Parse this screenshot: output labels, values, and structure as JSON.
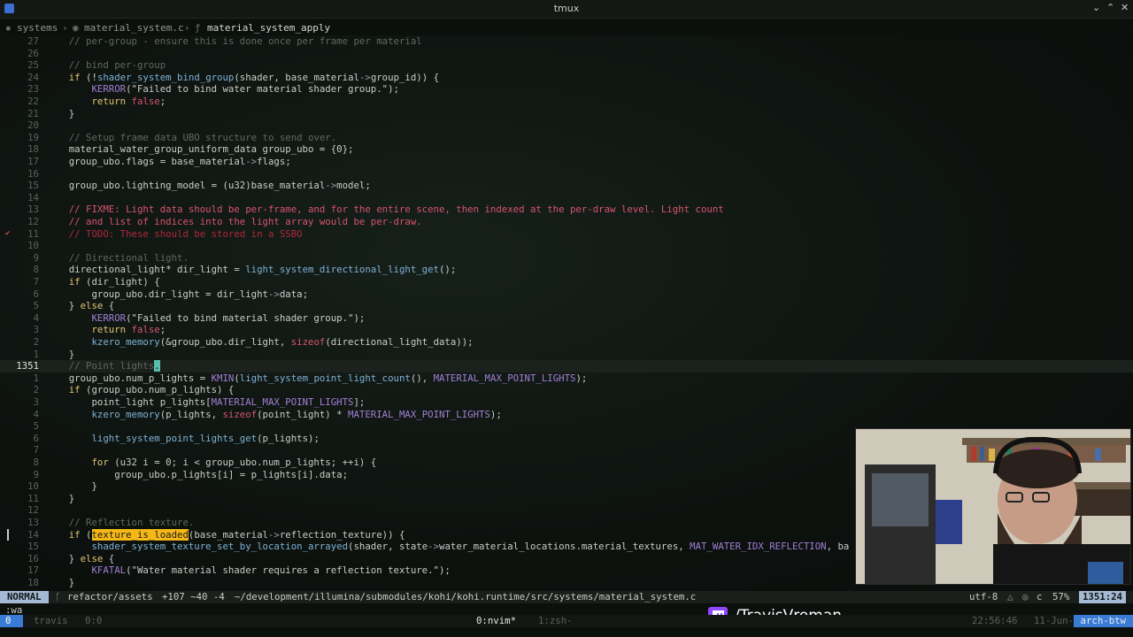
{
  "window": {
    "title": "tmux"
  },
  "window_controls": [
    "⌄",
    "⌃",
    "◇",
    "✕"
  ],
  "breadcrumb": {
    "folder": "systems",
    "file": "material_system.c",
    "function": "material_system_apply"
  },
  "lines": [
    {
      "ln": "27",
      "sign": "",
      "cursor": false,
      "html": "    <span class='cm'>// per-group - ensure this is done once per frame per material</span>"
    },
    {
      "ln": "26",
      "sign": "",
      "cursor": false,
      "html": ""
    },
    {
      "ln": "25",
      "sign": "",
      "cursor": false,
      "html": "    <span class='cm'>// bind per-group</span>"
    },
    {
      "ln": "24",
      "sign": "",
      "cursor": false,
      "html": "    <span class='kw'>if</span> (!<span class='fn'>shader_system_bind_group</span>(shader, base_material<span class='ptr'>-&gt;</span>group_id)) {"
    },
    {
      "ln": "23",
      "sign": "",
      "cursor": false,
      "html": "        <span class='mac'>KERROR</span>(\"Failed to bind water material shader group.\");"
    },
    {
      "ln": "22",
      "sign": "",
      "cursor": false,
      "html": "        <span class='kw'>return</span> <span class='fx'>false</span>;"
    },
    {
      "ln": "21",
      "sign": "",
      "cursor": false,
      "html": "    }"
    },
    {
      "ln": "20",
      "sign": "",
      "cursor": false,
      "html": ""
    },
    {
      "ln": "19",
      "sign": "",
      "cursor": false,
      "html": "    <span class='cm'>// Setup frame data UBO structure to send over.</span>"
    },
    {
      "ln": "18",
      "sign": "",
      "cursor": false,
      "html": "    material_water_group_uniform_data group_ubo = {0};"
    },
    {
      "ln": "17",
      "sign": "",
      "cursor": false,
      "html": "    group_ubo.flags = base_material<span class='ptr'>-&gt;</span>flags;"
    },
    {
      "ln": "16",
      "sign": "",
      "cursor": false,
      "html": ""
    },
    {
      "ln": "15",
      "sign": "",
      "cursor": false,
      "html": "    group_ubo.lighting_model = (u32)base_material<span class='ptr'>-&gt;</span>model;"
    },
    {
      "ln": "14",
      "sign": "",
      "cursor": false,
      "html": ""
    },
    {
      "ln": "13",
      "sign": "",
      "cursor": false,
      "html": "    <span class='fx'>// FIXME: Light data should be per-frame, and for the entire scene, then indexed at the per-draw level. Light count</span>"
    },
    {
      "ln": "12",
      "sign": "",
      "cursor": false,
      "html": "    <span class='fx'>// and list of indices into the light array would be per-draw.</span>"
    },
    {
      "ln": "11",
      "sign": "check",
      "cursor": false,
      "html": "    <span class='todo'>// TODO: These should be stored in a SSBO</span>"
    },
    {
      "ln": "10",
      "sign": "",
      "cursor": false,
      "html": ""
    },
    {
      "ln": "9",
      "sign": "",
      "cursor": false,
      "html": "    <span class='cm'>// Directional light.</span>"
    },
    {
      "ln": "8",
      "sign": "",
      "cursor": false,
      "html": "    directional_light* dir_light = <span class='fn'>light_system_directional_light_get</span>();"
    },
    {
      "ln": "7",
      "sign": "",
      "cursor": false,
      "html": "    <span class='kw'>if</span> (dir_light) {"
    },
    {
      "ln": "6",
      "sign": "",
      "cursor": false,
      "html": "        group_ubo.dir_light = dir_light<span class='ptr'>-&gt;</span>data;"
    },
    {
      "ln": "5",
      "sign": "",
      "cursor": false,
      "html": "    } <span class='kw'>else</span> {"
    },
    {
      "ln": "4",
      "sign": "",
      "cursor": false,
      "html": "        <span class='mac'>KERROR</span>(\"Failed to bind material shader group.\");"
    },
    {
      "ln": "3",
      "sign": "",
      "cursor": false,
      "html": "        <span class='kw'>return</span> <span class='fx'>false</span>;"
    },
    {
      "ln": "2",
      "sign": "",
      "cursor": false,
      "html": "        <span class='fn'>kzero_memory</span>(&amp;group_ubo.dir_light, <span class='fx'>sizeof</span>(directional_light_data));"
    },
    {
      "ln": "1",
      "sign": "",
      "cursor": false,
      "html": "    }"
    },
    {
      "ln": "1351",
      "sign": "",
      "cursor": true,
      "html": "    <span class='cm'>// Point lights</span><span class='cur'>.</span>"
    },
    {
      "ln": "1",
      "sign": "",
      "cursor": false,
      "html": "    group_ubo.num_p_lights = <span class='mac'>KMIN</span>(<span class='fn'>light_system_point_light_count</span>(), <span class='mac'>MATERIAL_MAX_POINT_LIGHTS</span>);"
    },
    {
      "ln": "2",
      "sign": "",
      "cursor": false,
      "html": "    <span class='kw'>if</span> (group_ubo.num_p_lights) {"
    },
    {
      "ln": "3",
      "sign": "",
      "cursor": false,
      "html": "        point_light p_lights[<span class='mac'>MATERIAL_MAX_POINT_LIGHTS</span>];"
    },
    {
      "ln": "4",
      "sign": "",
      "cursor": false,
      "html": "        <span class='fn'>kzero_memory</span>(p_lights, <span class='fx'>sizeof</span>(point_light) * <span class='mac'>MATERIAL_MAX_POINT_LIGHTS</span>);"
    },
    {
      "ln": "5",
      "sign": "",
      "cursor": false,
      "html": ""
    },
    {
      "ln": "6",
      "sign": "",
      "cursor": false,
      "html": "        <span class='fn'>light_system_point_lights_get</span>(p_lights);"
    },
    {
      "ln": "7",
      "sign": "",
      "cursor": false,
      "html": ""
    },
    {
      "ln": "8",
      "sign": "",
      "cursor": false,
      "html": "        <span class='kw'>for</span> (u32 i = 0; i &lt; group_ubo.num_p_lights; ++i) {"
    },
    {
      "ln": "9",
      "sign": "",
      "cursor": false,
      "html": "            group_ubo.p_lights[i] = p_lights[i].data;"
    },
    {
      "ln": "10",
      "sign": "",
      "cursor": false,
      "html": "        }"
    },
    {
      "ln": "11",
      "sign": "",
      "cursor": false,
      "html": "    }"
    },
    {
      "ln": "12",
      "sign": "",
      "cursor": false,
      "html": ""
    },
    {
      "ln": "13",
      "sign": "",
      "cursor": false,
      "html": "    <span class='cm'>// Reflection texture.</span>"
    },
    {
      "ln": "14",
      "sign": "bar",
      "cursor": false,
      "html": "    <span class='kw'>if</span> (<span class='hl'>texture_is_loaded</span>(base_material<span class='ptr'>-&gt;</span>reflection_texture)) {"
    },
    {
      "ln": "15",
      "sign": "",
      "cursor": false,
      "html": "        <span class='fn'>shader_system_texture_set_by_location_arrayed</span>(shader, state<span class='ptr'>-&gt;</span>water_material_locations.material_textures, <span class='mac'>MAT_WATER_IDX_REFLECTION</span>, ba"
    },
    {
      "ln": "16",
      "sign": "",
      "cursor": false,
      "html": "    } <span class='kw'>else</span> {"
    },
    {
      "ln": "17",
      "sign": "",
      "cursor": false,
      "html": "        <span class='mac'>KFATAL</span>(\"Water material shader requires a reflection texture.\");"
    },
    {
      "ln": "18",
      "sign": "",
      "cursor": false,
      "html": "    }"
    }
  ],
  "statusline": {
    "mode": "NORMAL",
    "branch_icon": "git-branch-icon",
    "branch": "refactor/assets",
    "diff": "+107 ~40 -4",
    "path": "~/development/illumina/submodules/kohi/kohi.runtime/src/systems/material_system.c",
    "encoding": "utf-8",
    "filetype": "c",
    "percent": "57%",
    "position": "1351:24"
  },
  "cmdline": ":wa",
  "tmux": {
    "session_index": "0",
    "session_name": "travis",
    "pane": "0:0",
    "windows": [
      "0:nvim*",
      "1:zsh-"
    ],
    "time": "22:56:46",
    "date": "11-Jun-25",
    "host": "arch-btw"
  },
  "overlay": {
    "twitch_handle": "/TravisVroman"
  },
  "colors": {
    "background": "#0c100d",
    "mode_bg": "#a4b9d2",
    "tmux_accent": "#3a7bd5",
    "search_highlight": "#f5b816",
    "twitch_purple": "#9146ff"
  }
}
